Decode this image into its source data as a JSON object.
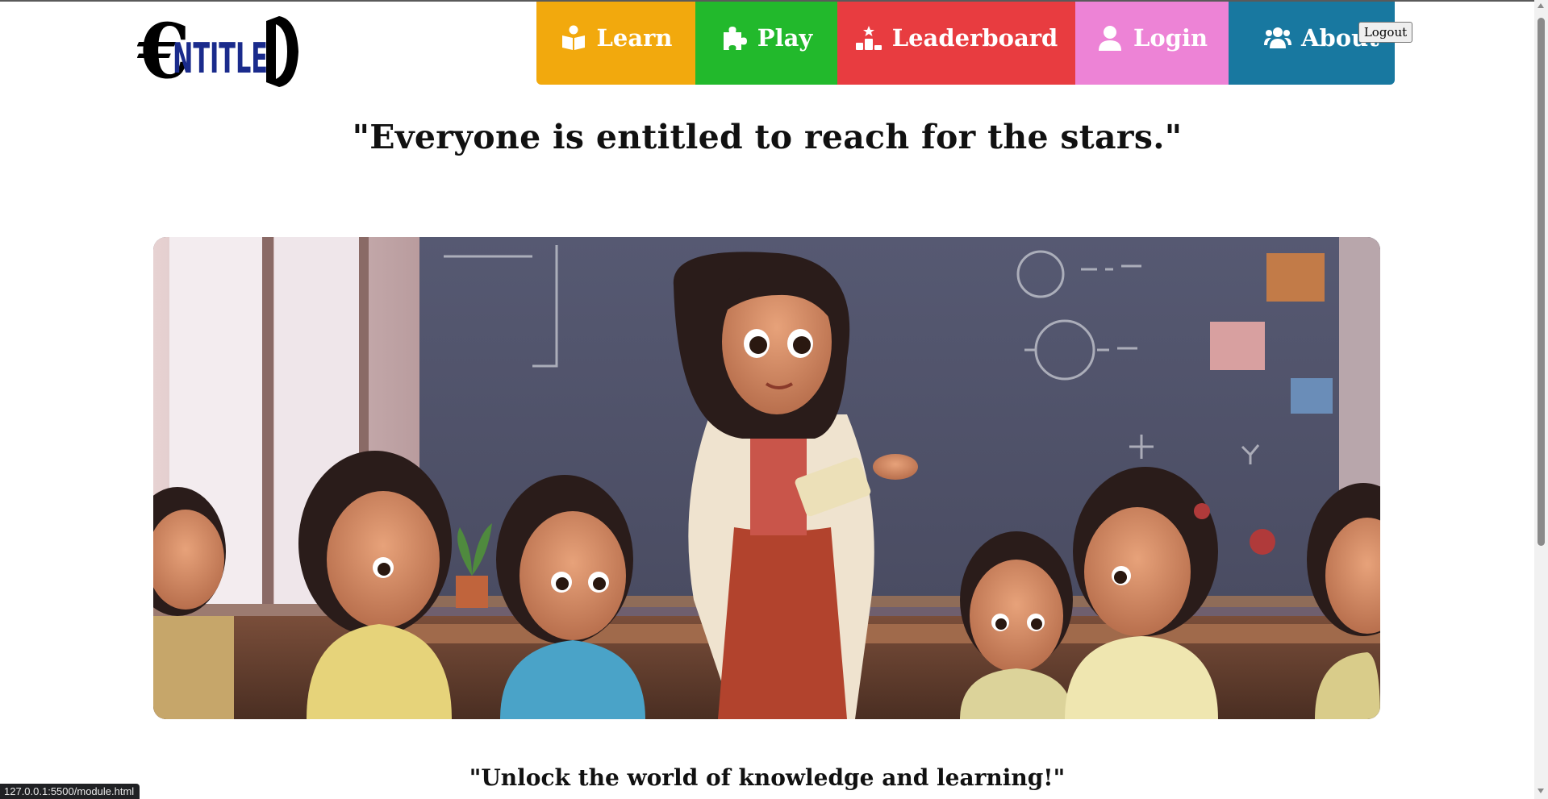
{
  "header": {
    "logo_text": "ENTITLED",
    "logo_icon": "entitled-logo"
  },
  "nav": {
    "items": [
      {
        "label": "Learn",
        "icon": "book-reader-icon",
        "color": "#f2a90d"
      },
      {
        "label": "Play",
        "icon": "puzzle-piece-icon",
        "color": "#22b92c"
      },
      {
        "label": "Leaderboard",
        "icon": "podium-icon",
        "color": "#e83c40"
      },
      {
        "label": "Login",
        "icon": "user-icon",
        "color": "#ed83d6"
      },
      {
        "label": "About",
        "icon": "users-icon",
        "color": "#1878a0"
      }
    ]
  },
  "auth": {
    "logout_label": "Logout"
  },
  "main": {
    "quote_top": "\"Everyone is entitled to reach for the stars.\"",
    "hero_image": "classroom-teacher-illustration",
    "quote_bottom": "\"Unlock the world of knowledge and learning!\""
  },
  "status_bar": {
    "url": "127.0.0.1:5500/module.html"
  }
}
